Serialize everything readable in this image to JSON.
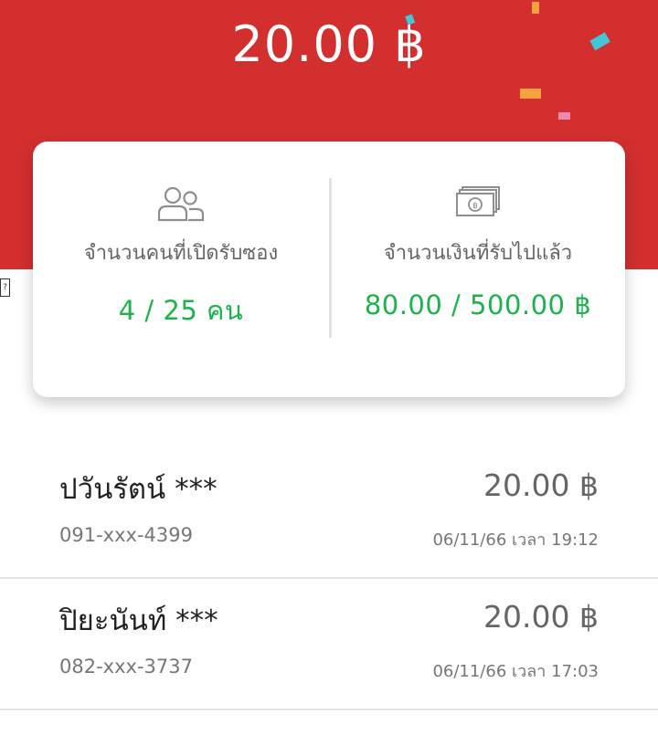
{
  "header": {
    "amount": "20.00 ฿",
    "background_color": "#d32f2f"
  },
  "stats": {
    "people": {
      "label": "จำนวนคนที่เปิดรับซอง",
      "value": "4 / 25 คน",
      "icon": "people-icon"
    },
    "money": {
      "label": "จำนวนเงินที่รับไปแล้ว",
      "value": "80.00 / 500.00 ฿",
      "icon": "banknote-icon"
    },
    "value_color": "#1bb34a"
  },
  "recipients": [
    {
      "name": "ปวันรัตน์ ***",
      "phone": "091-xxx-4399",
      "amount": "20.00 ฿",
      "time": "06/11/66 เวลา 19:12"
    },
    {
      "name": "ปิยะนันท์ ***",
      "phone": "082-xxx-3737",
      "amount": "20.00 ฿",
      "time": "06/11/66 เวลา 17:03"
    }
  ]
}
